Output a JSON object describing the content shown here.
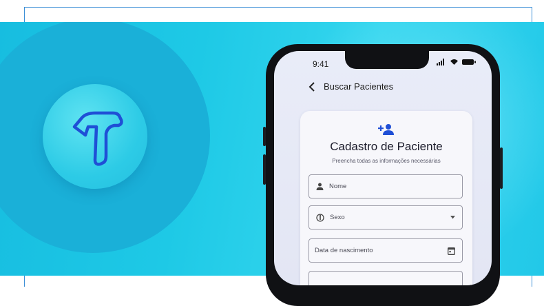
{
  "phone": {
    "status_time": "9:41",
    "nav_title": "Buscar Pacientes"
  },
  "form": {
    "title": "Cadastro de Paciente",
    "subtitle": "Preencha todas as informações necessárias",
    "fields": {
      "name_label": "Nome",
      "sex_label": "Sexo",
      "birth_label": "Data de nascimento"
    }
  },
  "colors": {
    "background_cyan": "#1ec9e6",
    "accent_blue": "#1f4fd6",
    "frame_line": "#3d8fd6"
  },
  "icons": {
    "brand_logo": "brand-t-logo",
    "add_person": "person-add-icon",
    "name_field": "person-icon",
    "sex_field": "gender-icon",
    "dropdown": "chevron-down-icon",
    "date_field": "calendar-icon",
    "back": "chevron-left-icon"
  }
}
